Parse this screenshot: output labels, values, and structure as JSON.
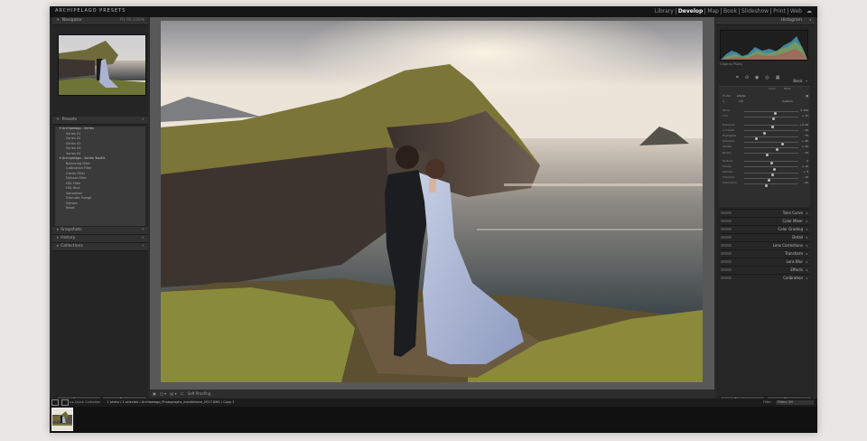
{
  "app": {
    "brand": "ARCHIPELAGO PRESETS"
  },
  "modules": [
    "Library",
    "Develop",
    "Map",
    "Book",
    "Slideshow",
    "Print",
    "Web"
  ],
  "active_module": "Develop",
  "left_panel": {
    "navigator": {
      "title": "Navigator",
      "zoom": [
        "Fit",
        "Fill",
        "100%"
      ]
    },
    "presets": {
      "title": "Presets",
      "groups": [
        {
          "name": "Archipelago - Series",
          "items": [
            "Series 01",
            "Series 02",
            "Series 03",
            "Series 04",
            "Series 05"
          ]
        },
        {
          "name": "Archipelago - Series Toolkit",
          "items": [
            "Balancing Filter",
            "Calibration Filter",
            "Clarity Filter",
            "Dehaze Filter",
            "HSL Filter",
            "HSL Blue",
            "Saturation",
            "Dramatic Range",
            "Vibrant",
            "Reset"
          ]
        }
      ]
    },
    "snapshots": "Snapshots",
    "history": "History",
    "collections": "Collections",
    "copy_label": "Copy...",
    "paste_label": "Paste"
  },
  "center": {
    "softproof": "Soft Proofing"
  },
  "right_panel": {
    "histogram_title": "Histogram",
    "histogram_info": "Original Photo",
    "basic_title": "Basic",
    "treatment": [
      "Color",
      "B&W"
    ],
    "profile_label": "Profile",
    "profile_value": "Adobe",
    "wb_label": "WB",
    "wb_value": "Custom",
    "sliders": [
      {
        "label": "Temp",
        "value": "5,794",
        "pos": 0.58
      },
      {
        "label": "Tint",
        "value": "+ 12",
        "pos": 0.54
      },
      {
        "label": "Exposure",
        "value": "+ 0.20",
        "pos": 0.52
      },
      {
        "label": "Contrast",
        "value": "- 30",
        "pos": 0.38
      },
      {
        "label": "Highlights",
        "value": "- 75",
        "pos": 0.22
      },
      {
        "label": "Shadows",
        "value": "+ 45",
        "pos": 0.7
      },
      {
        "label": "Whites",
        "value": "+ 20",
        "pos": 0.6
      },
      {
        "label": "Blacks",
        "value": "- 15",
        "pos": 0.42
      },
      {
        "label": "Texture",
        "value": "0",
        "pos": 0.5
      },
      {
        "label": "Clarity",
        "value": "+ 10",
        "pos": 0.55
      },
      {
        "label": "Dehaze",
        "value": "+ 5",
        "pos": 0.52
      },
      {
        "label": "Vibrance",
        "value": "- 10",
        "pos": 0.45
      },
      {
        "label": "Saturation",
        "value": "- 20",
        "pos": 0.4
      }
    ],
    "sections": [
      "Tone Curve",
      "Color Mixer",
      "Color Grading",
      "Detail",
      "Lens Corrections",
      "Transform",
      "Lens Blur",
      "Effects",
      "Calibration"
    ],
    "previous_label": "Previous",
    "reset_label": "Reset"
  },
  "filmstrip": {
    "source": "Quick Collection",
    "path": "1 photo / 1 selected / Archipelago_Photographs_monteleone_2017.DNG / Copy 1",
    "filter_label": "Filter:",
    "filter_value": "Filters Off"
  }
}
